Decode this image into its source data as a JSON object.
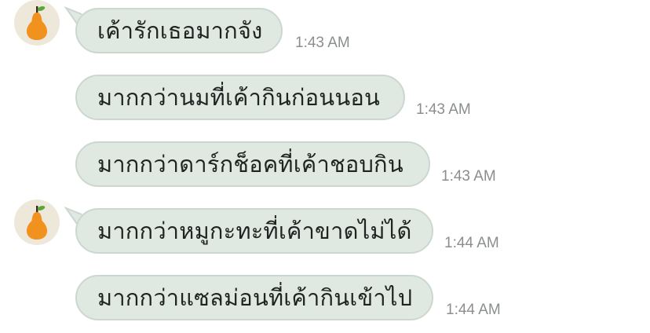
{
  "messages": [
    {
      "text": "เค้ารักเธอมากจัง",
      "time": "1:43 AM",
      "show_avatar": true
    },
    {
      "text": "มากกว่านมที่เค้ากินก่อนนอน",
      "time": "1:43 AM",
      "show_avatar": false
    },
    {
      "text": "มากกว่าดาร์กช็อคที่เค้าชอบกิน",
      "time": "1:43 AM",
      "show_avatar": false
    },
    {
      "text": "มากกว่าหมูกะทะที่เค้าขาดไม่ได้",
      "time": "1:44 AM",
      "show_avatar": true
    },
    {
      "text": "มากกว่าแซลม่อนที่เค้ากินเข้าไป",
      "time": "1:44 AM",
      "show_avatar": false
    }
  ],
  "avatar": {
    "icon": "pear-icon",
    "fruit_color": "#f2921e",
    "leaf_color": "#5aa83a",
    "background": "#ede8d9"
  },
  "colors": {
    "bubble_fill": "#e0e8e2",
    "bubble_border": "#cbd7cf",
    "text": "#1e2421",
    "time": "#8a8f8c"
  }
}
